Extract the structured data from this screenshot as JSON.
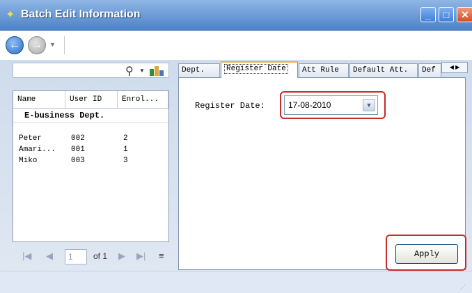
{
  "window": {
    "title": "Batch Edit Information"
  },
  "search": {
    "value": ""
  },
  "grid": {
    "columns": [
      "Name",
      "User ID",
      "Enrol..."
    ],
    "group": "E-business Dept.",
    "rows": [
      {
        "name": "Peter",
        "user_id": "002",
        "enrol": "2"
      },
      {
        "name": "Amari...",
        "user_id": "001",
        "enrol": "1"
      },
      {
        "name": "Miko",
        "user_id": "003",
        "enrol": "3"
      }
    ]
  },
  "pager": {
    "page": "1",
    "of_label": "of 1"
  },
  "tabs": [
    {
      "label": "Dept."
    },
    {
      "label": "Register Date",
      "active": true
    },
    {
      "label": "Att Rule"
    },
    {
      "label": "Default Att."
    },
    {
      "label": "Def"
    }
  ],
  "form": {
    "register_date_label": "Register Date:",
    "register_date_value": "17-08-2010"
  },
  "buttons": {
    "apply": "Apply"
  },
  "colors": {
    "highlight": "#c92a2a",
    "titlebar": "#4d82c9",
    "active_tab_accent": "#e9b34a"
  },
  "icons": {
    "title": "app-icon",
    "minimize": "minimize-icon",
    "maximize": "maximize-icon",
    "close": "close-icon",
    "back": "back-arrow-icon",
    "forward": "forward-arrow-icon",
    "search": "search-icon",
    "filter": "filter-icon"
  }
}
